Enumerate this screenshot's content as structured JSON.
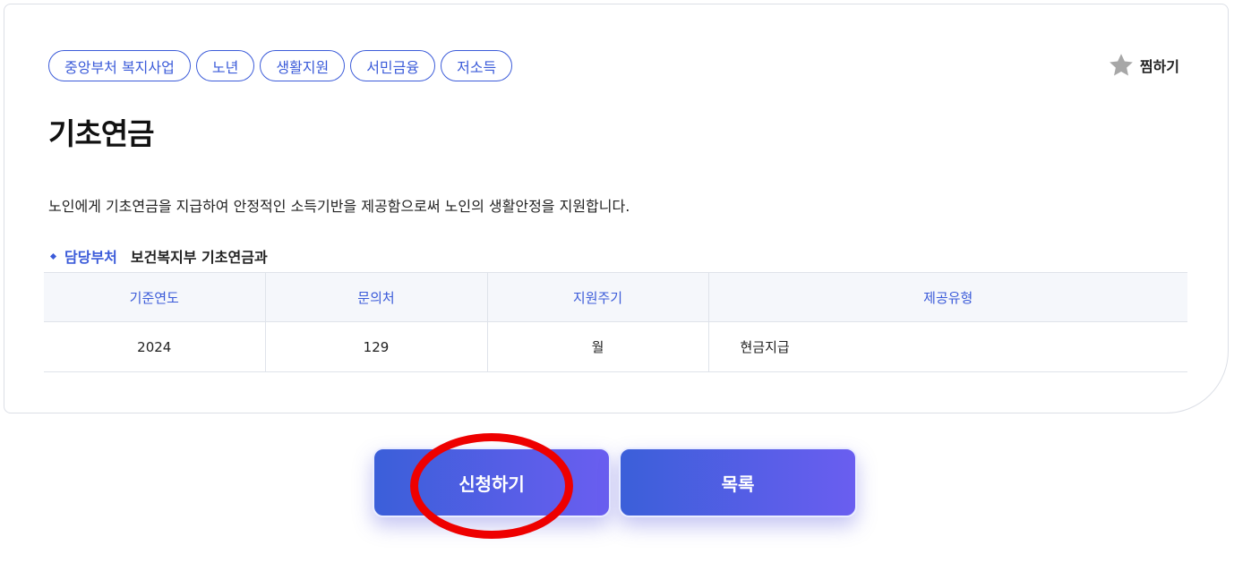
{
  "tags": [
    "중앙부처 복지사업",
    "노년",
    "생활지원",
    "서민금융",
    "저소득"
  ],
  "favorite": {
    "label": "찜하기",
    "icon": "star-icon"
  },
  "title": "기초연금",
  "description": "노인에게 기초연금을 지급하여 안정적인 소득기반을 제공함으로써 노인의 생활안정을 지원합니다.",
  "department": {
    "label": "담당부처",
    "value": "보건복지부 기초연금과"
  },
  "table": {
    "headers": [
      "기준연도",
      "문의처",
      "지원주기",
      "제공유형"
    ],
    "rows": [
      [
        "2024",
        "129",
        "월",
        "현금지급"
      ]
    ]
  },
  "buttons": {
    "apply": "신청하기",
    "list": "목록"
  },
  "colors": {
    "accent": "#3b5bd9",
    "annotation": "#ee0000"
  }
}
